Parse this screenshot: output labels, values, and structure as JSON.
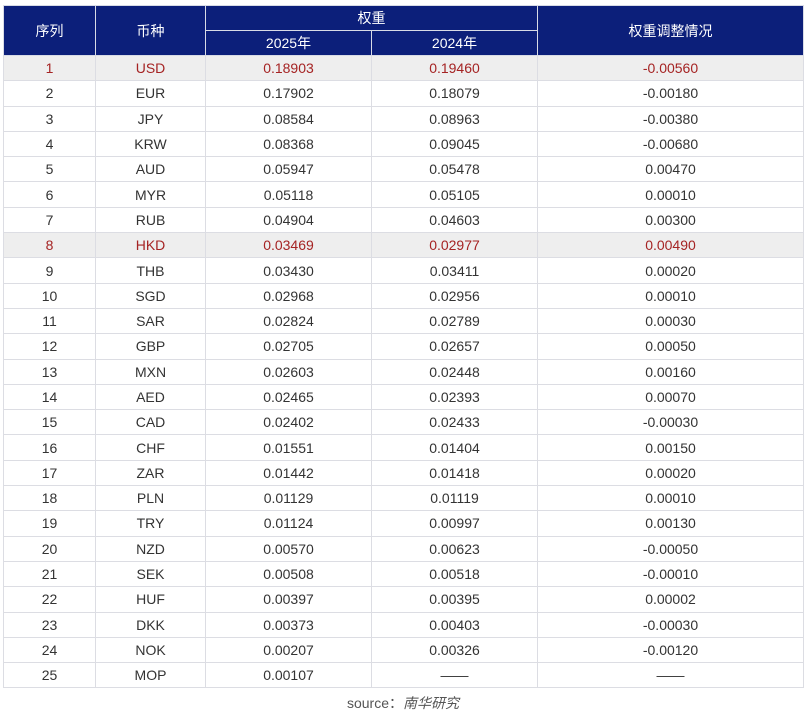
{
  "header": {
    "index": "序列",
    "currency": "币种",
    "weight": "权重",
    "y2025": "2025年",
    "y2024": "2024年",
    "change": "权重调整情况"
  },
  "highlight_color": "#a52323",
  "rows": [
    {
      "i": "1",
      "c": "USD",
      "a": "0.18903",
      "b": "0.19460",
      "d": "-0.00560",
      "hl": true
    },
    {
      "i": "2",
      "c": "EUR",
      "a": "0.17902",
      "b": "0.18079",
      "d": "-0.00180"
    },
    {
      "i": "3",
      "c": "JPY",
      "a": "0.08584",
      "b": "0.08963",
      "d": "-0.00380"
    },
    {
      "i": "4",
      "c": "KRW",
      "a": "0.08368",
      "b": "0.09045",
      "d": "-0.00680"
    },
    {
      "i": "5",
      "c": "AUD",
      "a": "0.05947",
      "b": "0.05478",
      "d": "0.00470"
    },
    {
      "i": "6",
      "c": "MYR",
      "a": "0.05118",
      "b": "0.05105",
      "d": "0.00010"
    },
    {
      "i": "7",
      "c": "RUB",
      "a": "0.04904",
      "b": "0.04603",
      "d": "0.00300"
    },
    {
      "i": "8",
      "c": "HKD",
      "a": "0.03469",
      "b": "0.02977",
      "d": "0.00490",
      "hl": true
    },
    {
      "i": "9",
      "c": "THB",
      "a": "0.03430",
      "b": "0.03411",
      "d": "0.00020"
    },
    {
      "i": "10",
      "c": "SGD",
      "a": "0.02968",
      "b": "0.02956",
      "d": "0.00010"
    },
    {
      "i": "11",
      "c": "SAR",
      "a": "0.02824",
      "b": "0.02789",
      "d": "0.00030"
    },
    {
      "i": "12",
      "c": "GBP",
      "a": "0.02705",
      "b": "0.02657",
      "d": "0.00050"
    },
    {
      "i": "13",
      "c": "MXN",
      "a": "0.02603",
      "b": "0.02448",
      "d": "0.00160"
    },
    {
      "i": "14",
      "c": "AED",
      "a": "0.02465",
      "b": "0.02393",
      "d": "0.00070"
    },
    {
      "i": "15",
      "c": "CAD",
      "a": "0.02402",
      "b": "0.02433",
      "d": "-0.00030"
    },
    {
      "i": "16",
      "c": "CHF",
      "a": "0.01551",
      "b": "0.01404",
      "d": "0.00150"
    },
    {
      "i": "17",
      "c": "ZAR",
      "a": "0.01442",
      "b": "0.01418",
      "d": "0.00020"
    },
    {
      "i": "18",
      "c": "PLN",
      "a": "0.01129",
      "b": "0.01119",
      "d": "0.00010"
    },
    {
      "i": "19",
      "c": "TRY",
      "a": "0.01124",
      "b": "0.00997",
      "d": "0.00130"
    },
    {
      "i": "20",
      "c": "NZD",
      "a": "0.00570",
      "b": "0.00623",
      "d": "-0.00050"
    },
    {
      "i": "21",
      "c": "SEK",
      "a": "0.00508",
      "b": "0.00518",
      "d": "-0.00010"
    },
    {
      "i": "22",
      "c": "HUF",
      "a": "0.00397",
      "b": "0.00395",
      "d": "0.00002"
    },
    {
      "i": "23",
      "c": "DKK",
      "a": "0.00373",
      "b": "0.00403",
      "d": "-0.00030"
    },
    {
      "i": "24",
      "c": "NOK",
      "a": "0.00207",
      "b": "0.00326",
      "d": "-0.00120"
    },
    {
      "i": "25",
      "c": "MOP",
      "a": "0.00107",
      "b": "——",
      "d": "——"
    }
  ],
  "source": {
    "label": "source：",
    "name": "南华研究"
  }
}
